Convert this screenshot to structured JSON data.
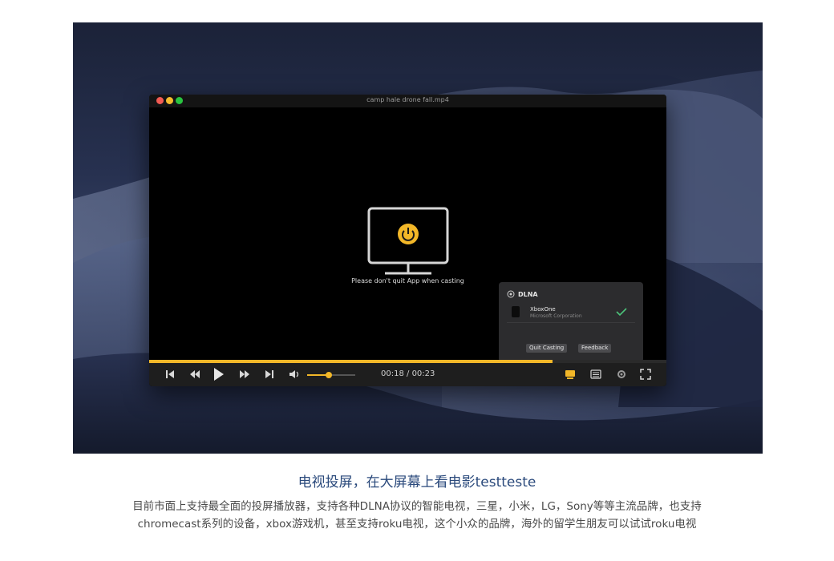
{
  "window": {
    "title": "camp hale drone fall.mp4"
  },
  "player": {
    "cast_message": "Please don't quit App when casting",
    "current_time": "00:18",
    "total_time": "00:23",
    "time_separator": " / ",
    "progress": 0.78,
    "volume": 0.45,
    "accent_color": "#f2b728"
  },
  "dlna": {
    "title": "DLNA",
    "device": {
      "name": "XboxOne",
      "manufacturer": "Microsoft Corporation",
      "selected": true
    },
    "quit_label": "Quit Casting",
    "feedback_label": "Feedback"
  },
  "controls": {
    "icons": [
      "skip-back-icon",
      "rewind-icon",
      "play-icon",
      "fast-forward-icon",
      "skip-forward-icon",
      "volume-icon",
      "cast-icon",
      "playlist-icon",
      "settings-icon",
      "fullscreen-icon"
    ]
  },
  "caption": {
    "heading": "电视投屏，在大屏幕上看电影testteste",
    "line1": "目前市面上支持最全面的投屏播放器，支持各种DLNA协议的智能电视，三星，小米，LG，Sony等等主流品牌，也支持",
    "line2": "chromecast系列的设备，xbox游戏机，甚至支持roku电视，这个小众的品牌，海外的留学生朋友可以试试roku电视"
  }
}
